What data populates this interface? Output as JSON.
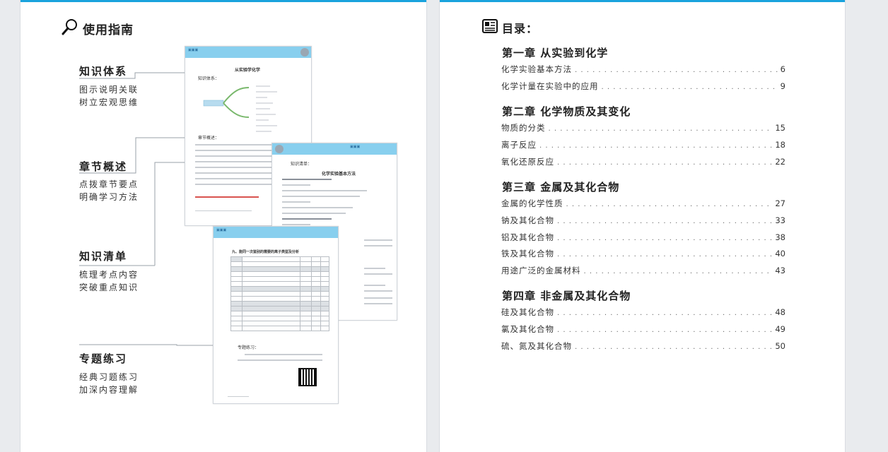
{
  "guide": {
    "title": "使用指南",
    "sections": [
      {
        "title": "知识体系",
        "desc": [
          "图示说明关联",
          "树立宏观思维"
        ]
      },
      {
        "title": "章节概述",
        "desc": [
          "点拨章节要点",
          "明确学习方法"
        ]
      },
      {
        "title": "知识清单",
        "desc": [
          "梳理考点内容",
          "突破重点知识"
        ]
      },
      {
        "title": "专题练习",
        "desc": [
          "经典习题练习",
          "加深内容理解"
        ]
      }
    ]
  },
  "thumbnails": {
    "page1": {
      "title": "从实验学化学",
      "sec1": "知识体系：",
      "sec2": "章节概述："
    },
    "page2": {
      "sec": "知识清单：",
      "title": "化学实验基本方法"
    },
    "page3": {
      "title": "九、能同一次鉴别的需要的离子类型及分析",
      "sec": "专题练习："
    }
  },
  "toc": {
    "title": "目录：",
    "chapters": [
      {
        "title": "第一章  从实验到化学",
        "entries": [
          {
            "label": "化学实验基本方法",
            "page": "6"
          },
          {
            "label": "化学计量在实验中的应用",
            "page": "9"
          }
        ]
      },
      {
        "title": "第二章  化学物质及其变化",
        "entries": [
          {
            "label": "物质的分类",
            "page": "15"
          },
          {
            "label": "离子反应",
            "page": "18"
          },
          {
            "label": "氧化还原反应",
            "page": "22"
          }
        ]
      },
      {
        "title": "第三章  金属及其化合物",
        "entries": [
          {
            "label": "金属的化学性质",
            "page": "27"
          },
          {
            "label": "钠及其化合物",
            "page": "33"
          },
          {
            "label": "铝及其化合物",
            "page": "38"
          },
          {
            "label": "铁及其化合物",
            "page": "40"
          },
          {
            "label": "用途广泛的金属材料",
            "page": "43"
          }
        ]
      },
      {
        "title": "第四章  非金属及其化合物",
        "entries": [
          {
            "label": "硅及其化合物",
            "page": "48"
          },
          {
            "label": "氯及其化合物",
            "page": "49"
          },
          {
            "label": "硫、氮及其化合物",
            "page": "50"
          }
        ]
      }
    ]
  },
  "colors": {
    "accent": "#1aa3dd",
    "header": "#88cfee"
  },
  "icons": {
    "guide": "magnifier-icon",
    "toc": "newspaper-icon"
  }
}
